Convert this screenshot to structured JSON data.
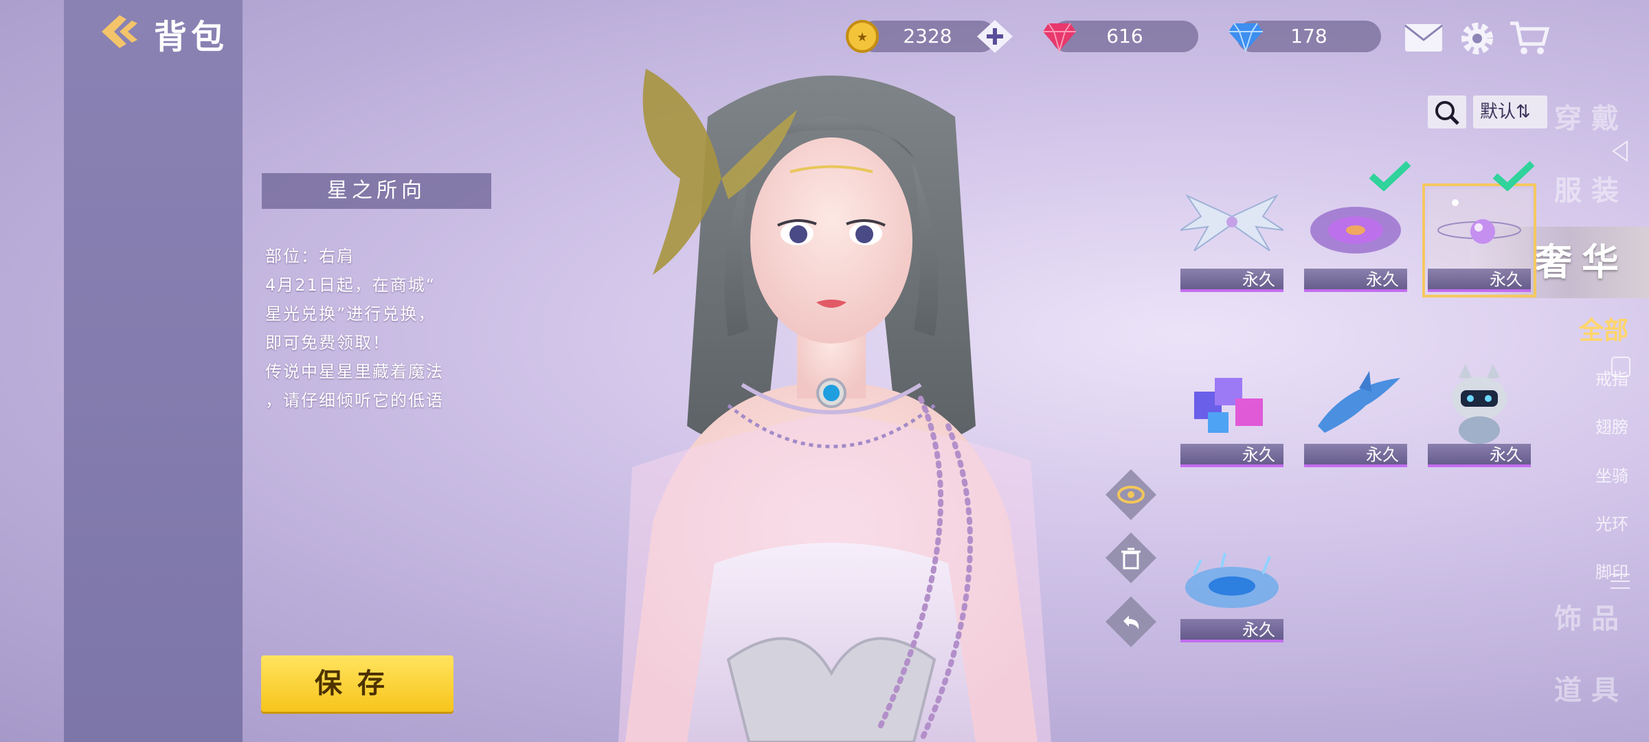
{
  "header": {
    "title": "背包"
  },
  "currencies": [
    {
      "name": "gold-coin",
      "value": "2328"
    },
    {
      "name": "pink-gem",
      "value": "616"
    },
    {
      "name": "blue-diamond",
      "value": "178"
    }
  ],
  "sidebar": {
    "categories": [
      "穿戴",
      "服装",
      "奢华",
      "饰品",
      "道具"
    ],
    "active_category": "奢华",
    "subcategories": [
      "全部",
      "戒指",
      "翅膀",
      "坐骑",
      "光环",
      "脚印"
    ],
    "active_subcategory": "全部"
  },
  "item": {
    "name": "星之所向",
    "description": [
      "部位：右肩",
      "4月21日起，在商城“",
      "星光兑换”进行兑换，",
      "即可免费领取！",
      "传说中星星里藏着魔法",
      "，请仔细倾听它的低语"
    ]
  },
  "toolbar": {
    "sort_label": "默认⇅",
    "save_label": "保存"
  },
  "inventory": [
    {
      "icon": "crystal-wings-icon",
      "duration": "永久",
      "checked": false,
      "selected": false
    },
    {
      "icon": "purple-halo-icon",
      "duration": "永久",
      "checked": true,
      "selected": false
    },
    {
      "icon": "star-orb-icon",
      "duration": "永久",
      "checked": true,
      "selected": true
    },
    {
      "icon": "cube-mount-icon",
      "duration": "永久",
      "checked": false,
      "selected": false
    },
    {
      "icon": "dolphin-mount-icon",
      "duration": "永久",
      "checked": false,
      "selected": false
    },
    {
      "icon": "robot-cat-icon",
      "duration": "永久",
      "checked": false,
      "selected": false
    },
    {
      "icon": "water-splash-icon",
      "duration": "永久",
      "checked": false,
      "selected": false
    }
  ],
  "colors": {
    "accent_gold": "#f5c860",
    "check_green": "#2fd39b",
    "label_purple": "#c26cf0"
  }
}
